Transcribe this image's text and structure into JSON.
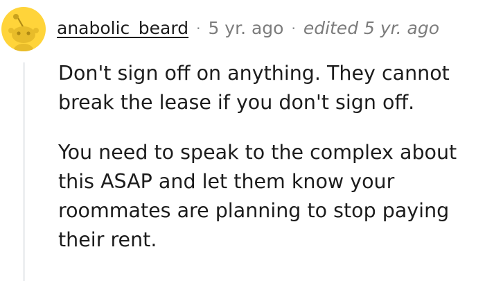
{
  "comment": {
    "author": "anabolic_beard",
    "separator": "·",
    "posted": "5 yr. ago",
    "edited": "edited 5 yr. ago",
    "avatar_icon": "reddit-snoo-icon",
    "avatar_color": "#ffd43a",
    "paragraphs": [
      "Don't sign off on anything. They cannot break the lease if you don't sign off.",
      "You need to speak to the complex about this ASAP and let them know your roommates are planning to stop paying their rent."
    ]
  }
}
